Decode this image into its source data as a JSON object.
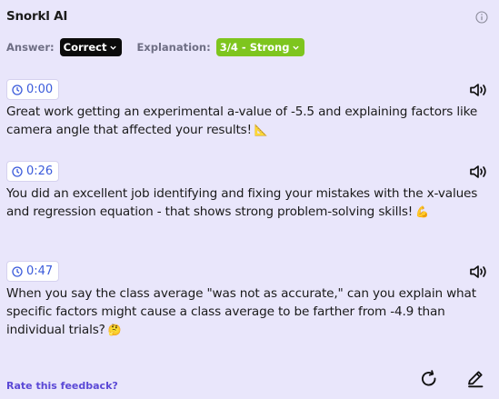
{
  "app_title": "Snorkl AI",
  "answer": {
    "label": "Answer:",
    "value": "Correct"
  },
  "explanation": {
    "label": "Explanation:",
    "value": "3/4 - Strong"
  },
  "entries": [
    {
      "time": "0:00",
      "text": "Great work getting an experimental a-value of -5.5 and explaining factors like camera angle that affected your results!",
      "emoji": "📐"
    },
    {
      "time": "0:26",
      "text": "You did an excellent job identifying and fixing your mistakes with the x-values and regression equation - that shows strong problem-solving skills!",
      "emoji": "💪"
    },
    {
      "time": "0:47",
      "text": "When you say the class average \"was not as accurate,\" can you explain what specific factors might cause a class average to be farther from -4.9 than individual trials?",
      "emoji": "🤔"
    }
  ],
  "footer": {
    "rate_label": "Rate this feedback?"
  },
  "colors": {
    "background": "#e9e6fb",
    "correct_pill": "#0b0b0b",
    "strong_pill": "#7ec51e",
    "time_text": "#3b5bdb",
    "link": "#5b49d6"
  },
  "icons": [
    "info-icon",
    "chevron-down-icon",
    "clock-icon",
    "speaker-icon",
    "refresh-icon",
    "edit-icon"
  ]
}
